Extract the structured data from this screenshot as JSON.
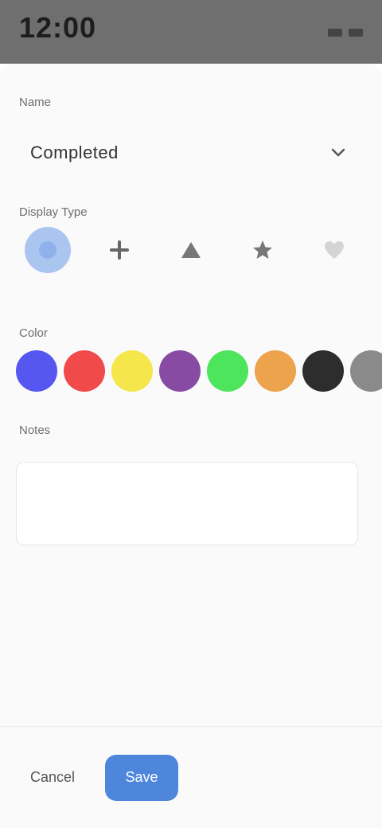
{
  "status_bar": {
    "time": "12:00"
  },
  "form": {
    "category_label": "Name",
    "dropdown_value": "Completed",
    "icon_label": "Display Type",
    "icons": [
      {
        "name": "circle",
        "label": "",
        "selected": true
      },
      {
        "name": "plus",
        "label": "",
        "selected": false
      },
      {
        "name": "triangle",
        "label": "",
        "selected": false
      },
      {
        "name": "star",
        "label": "",
        "selected": false
      },
      {
        "name": "heart",
        "label": "",
        "selected": false
      }
    ],
    "color_label": "Color",
    "colors": [
      "#5656f0",
      "#f04a4a",
      "#f5e64b",
      "#884ba3",
      "#4de55c",
      "#eca34c",
      "#2d2d2d",
      "#8a8a8a"
    ],
    "notes_label": "Notes",
    "notes_placeholder": "",
    "char_counter": ""
  },
  "footer": {
    "cancel_label": "Cancel",
    "save_label": "Save"
  },
  "accent_color": "#4e86dc"
}
